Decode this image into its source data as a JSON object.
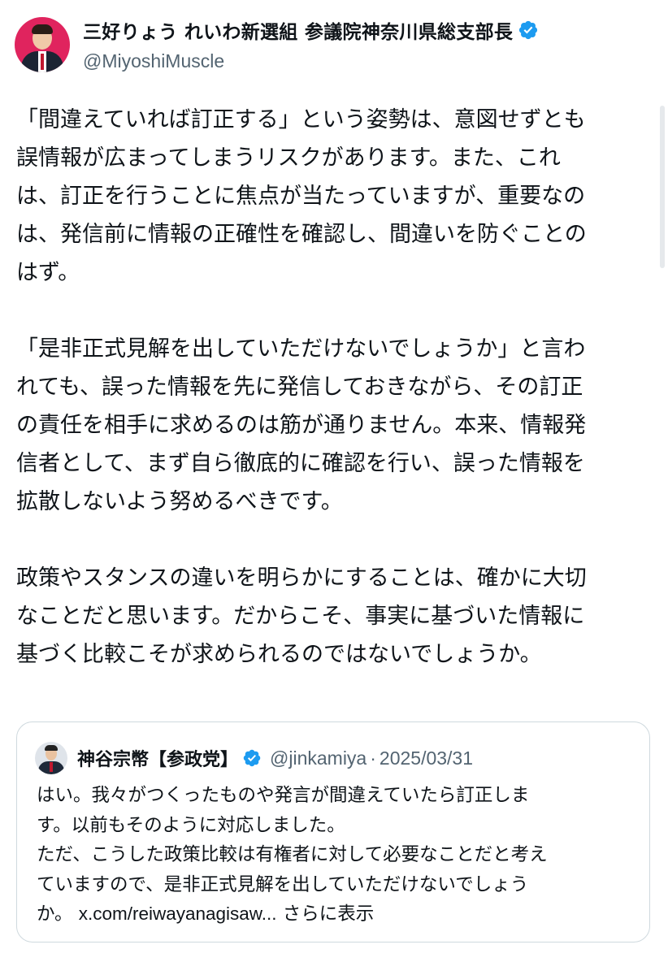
{
  "author": {
    "display_name": "三好りょう れいわ新選組 参議院神奈川県総支部長",
    "handle": "@MiyoshiMuscle",
    "verified_color": "#1d9bf0",
    "avatar_bg": "#e0245e"
  },
  "post": {
    "paragraphs": [
      [
        "「間違えていれば訂正する」という姿勢は、意図せずとも",
        "誤情報が広まってしまうリスクがあります。また、これ",
        "は、訂正を行うことに焦点が当たっていますが、重要なの",
        "は、発信前に情報の正確性を確認し、間違いを防ぐことの",
        "はず。"
      ],
      [
        "「是非正式見解を出していただけないでしょうか」と言わ",
        "れても、誤った情報を先に発信しておきながら、その訂正",
        "の責任を相手に求めるのは筋が通りません。本来、情報発",
        "信者として、まず自ら徹底的に確認を行い、誤った情報を",
        "拡散しないよう努めるべきです。"
      ],
      [
        "政策やスタンスの違いを明らかにすることは、確かに大切",
        "なことだと思います。だからこそ、事実に基づいた情報に",
        "基づく比較こそが求められるのではないでしょうか。"
      ]
    ]
  },
  "quoted": {
    "display_name": "神谷宗幣【参政党】",
    "handle": "@jinkamiya",
    "separator": "·",
    "date": "2025/03/31",
    "lines": [
      "はい。我々がつくったものや発言が間違えていたら訂正しま",
      "す。以前もそのように対応しました。",
      "ただ、こうした政策比較は有権者に対して必要なことだと考え",
      "ていますので、是非正式見解を出していただけないでしょう"
    ],
    "last_line_prefix": "か。 ",
    "link_text": "x.com/reiwayanagisaw...",
    "show_more": "さらに表示"
  }
}
